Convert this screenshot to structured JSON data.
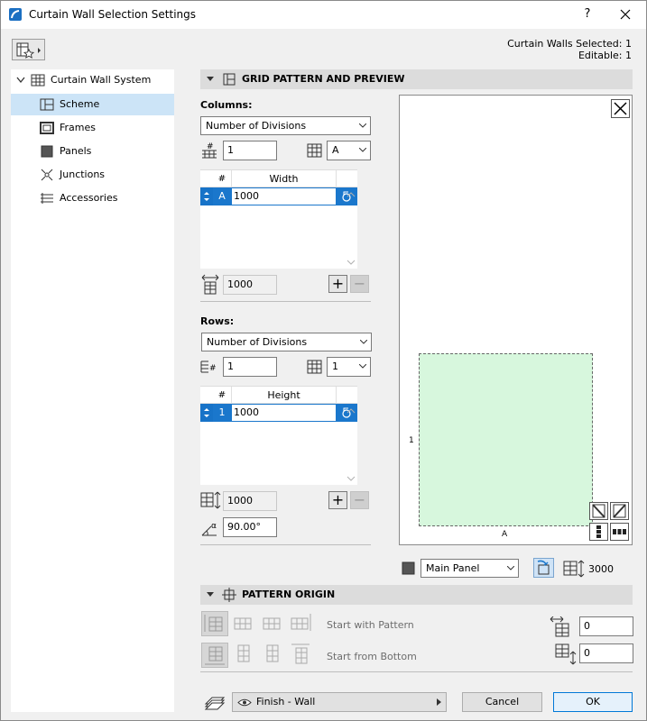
{
  "window": {
    "title": "Curtain Wall Selection Settings",
    "help": "?"
  },
  "selection": {
    "selected": "Curtain Walls Selected: 1",
    "editable": "Editable: 1"
  },
  "tree": {
    "root": "Curtain Wall System",
    "items": [
      {
        "label": "Scheme"
      },
      {
        "label": "Frames"
      },
      {
        "label": "Panels"
      },
      {
        "label": "Junctions"
      },
      {
        "label": "Accessories"
      }
    ]
  },
  "grid_section": {
    "title": "GRID PATTERN AND PREVIEW"
  },
  "columns": {
    "label": "Columns:",
    "mode": "Number of Divisions",
    "count": "1",
    "pattern_letter": "A",
    "table_header_index": "#",
    "table_header_value": "Width",
    "row_index": "A",
    "row_value": "1000",
    "total": "1000"
  },
  "rows": {
    "label": "Rows:",
    "mode": "Number of Divisions",
    "count": "1",
    "pattern_number": "1",
    "table_header_index": "#",
    "table_header_value": "Height",
    "row_index": "1",
    "row_value": "1000",
    "total": "1000",
    "angle": "90.00°"
  },
  "preview": {
    "column_label": "A",
    "row_label": "1"
  },
  "panel_select": {
    "value": "Main Panel",
    "height": "3000"
  },
  "origin_section": {
    "title": "PATTERN ORIGIN",
    "start_pattern": "Start with Pattern",
    "start_bottom": "Start from Bottom",
    "offset_x": "0",
    "offset_y": "0"
  },
  "footer": {
    "layer": "Finish - Wall",
    "cancel": "Cancel",
    "ok": "OK"
  },
  "colors": {
    "accent": "#1a77cc",
    "selection": "#cce4f7",
    "panel": "#d7f7dd"
  }
}
